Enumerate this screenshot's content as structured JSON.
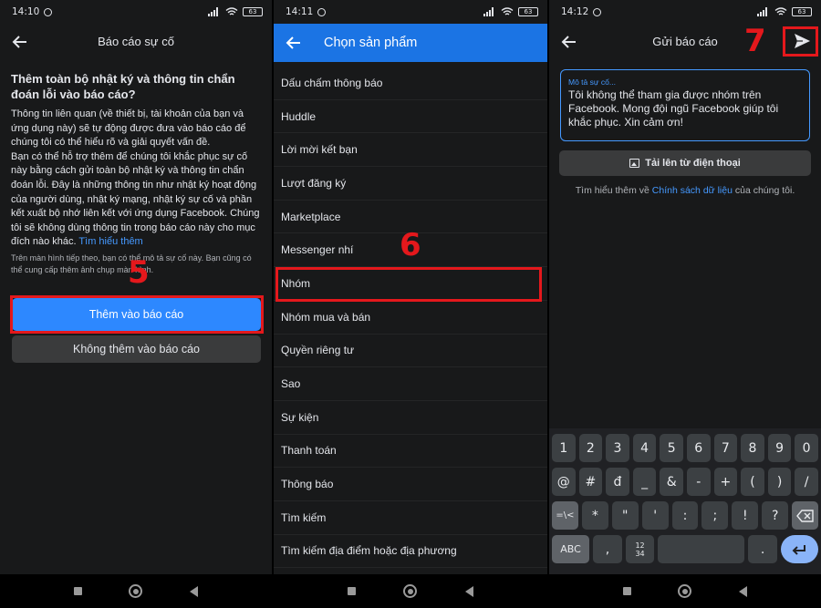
{
  "status": {
    "panel1_time": "14:10",
    "panel2_time": "14:11",
    "panel3_time": "14:12",
    "battery": "63"
  },
  "panel1": {
    "title": "Báo cáo sự cố",
    "heading": "Thêm toàn bộ nhật ký và thông tin chẩn đoán lỗi vào báo cáo?",
    "body1": "Thông tin liên quan (về thiết bị, tài khoản của bạn và ứng dụng này) sẽ tự động được đưa vào báo cáo để chúng tôi có thể hiểu rõ và giải quyết vấn đề.",
    "body2": "Bạn có thể hỗ trợ thêm để chúng tôi khắc phục sự cố này bằng cách gửi toàn bộ nhật ký và thông tin chẩn đoán lỗi. Đây là những thông tin như nhật ký hoạt động của người dùng, nhật ký mạng, nhật ký sự cố và phần kết xuất bộ nhớ liên kết với ứng dụng Facebook. Chúng tôi sẽ không dùng thông tin trong báo cáo này cho mục đích nào khác.",
    "learn_more": "Tìm hiểu thêm",
    "note": "Trên màn hình tiếp theo, bạn có thể mô tả sự cố này. Bạn cũng có thể cung cấp thêm ảnh chụp màn hình.",
    "add_button": "Thêm vào báo cáo",
    "dont_add_button": "Không thêm vào báo cáo",
    "step": "5"
  },
  "panel2": {
    "title": "Chọn sản phẩm",
    "items": [
      "Dấu chấm thông báo",
      "Huddle",
      "Lời mời kết bạn",
      "Lượt đăng ký",
      "Marketplace",
      "Messenger nhí",
      "Nhóm",
      "Nhóm mua và bán",
      "Quyền riêng tư",
      "Sao",
      "Sự kiện",
      "Thanh toán",
      "Thông báo",
      "Tìm kiếm",
      "Tìm kiếm địa điểm hoặc địa phương"
    ],
    "step": "6"
  },
  "panel3": {
    "title": "Gửi báo cáo",
    "desc_label": "Mô tả sự cố...",
    "desc_text": "Tôi không thể tham gia được nhóm trên Facebook. Mong đội ngũ Facebook giúp tôi khắc phục. Xin cảm ơn!",
    "upload": "Tải lên từ điện thoại",
    "learn_prefix": "Tìm hiểu thêm về ",
    "learn_link": "Chính sách dữ liệu",
    "learn_suffix": " của chúng tôi.",
    "step": "7",
    "keys_row1": [
      "1",
      "2",
      "3",
      "4",
      "5",
      "6",
      "7",
      "8",
      "9",
      "0"
    ],
    "keys_row2": [
      "@",
      "#",
      "đ",
      "_",
      "&",
      "-",
      "+",
      "(",
      ")",
      "/"
    ],
    "keys_row3": [
      "=\\<",
      "*",
      "\"",
      "'",
      ":",
      ";",
      "!",
      "?"
    ],
    "keys_row4_left": "ABC",
    "keys_row4_comma": ",",
    "keys_row4_numpad_top": "12",
    "keys_row4_numpad_bottom": "34",
    "keys_row4_period": "."
  }
}
